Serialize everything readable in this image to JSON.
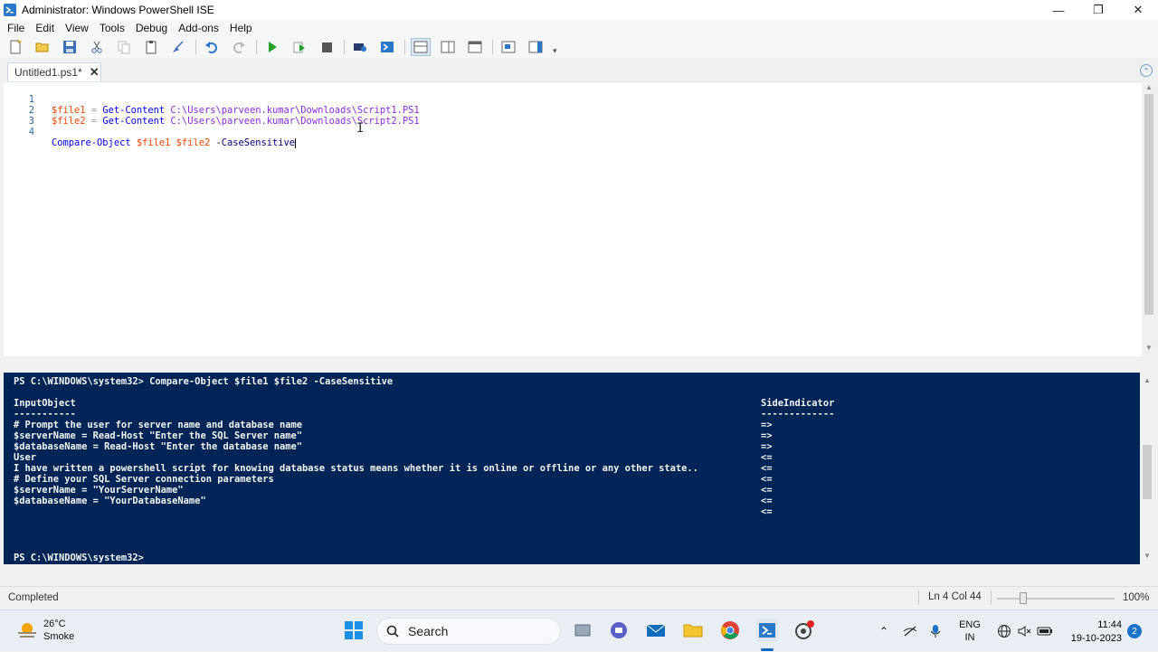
{
  "window": {
    "title": "Administrator: Windows PowerShell ISE",
    "minimize_glyph": "—",
    "maximize_glyph": "❐",
    "close_glyph": "✕"
  },
  "menu": [
    "File",
    "Edit",
    "View",
    "Tools",
    "Debug",
    "Add-ons",
    "Help"
  ],
  "tab": {
    "label": "Untitled1.ps1*",
    "close_glyph": "✕"
  },
  "editor": {
    "lines": [
      {
        "num": "1",
        "var": "$file1",
        "op": " = ",
        "cmd": "Get-Content",
        "arg": "C:\\Users\\parveen.kumar\\Downloads\\Script1.PS1"
      },
      {
        "num": "2",
        "var": "$file2",
        "op": " = ",
        "cmd": "Get-Content",
        "arg": "C:\\Users\\parveen.kumar\\Downloads\\Script2.PS1"
      },
      {
        "num": "3"
      },
      {
        "num": "4",
        "cmd": "Compare-Object",
        "var1": "$file1",
        "var2": "$file2",
        "param": "-CaseSensitive"
      }
    ]
  },
  "console": {
    "command_line": "PS C:\\WINDOWS\\system32> Compare-Object $file1 $file2 -CaseSensitive",
    "col1_header": "InputObject",
    "col1_underline": "-----------",
    "col2_header": "SideIndicator",
    "col2_underline": "-------------",
    "rows": [
      {
        "input": "# Prompt the user for server name and database name",
        "side": "=>"
      },
      {
        "input": "$serverName = Read-Host \"Enter the SQL Server name\"",
        "side": "=>"
      },
      {
        "input": "$databaseName = Read-Host \"Enter the database name\"",
        "side": "=>"
      },
      {
        "input": "User",
        "side": "<="
      },
      {
        "input": "I have written a powershell script for knowing database status means whether it is online or offline or any other state..",
        "side": "<="
      },
      {
        "input": "# Define your SQL Server connection parameters",
        "side": "<="
      },
      {
        "input": "$serverName = \"YourServerName\"",
        "side": "<="
      },
      {
        "input": "$databaseName = \"YourDatabaseName\"",
        "side": "<="
      },
      {
        "input": "",
        "side": "<="
      }
    ],
    "prompt": "PS C:\\WINDOWS\\system32>"
  },
  "status": {
    "text": "Completed",
    "position": "Ln 4  Col 44",
    "zoom": "100%"
  },
  "taskbar": {
    "weather_temp": "26°C",
    "weather_desc": "Smoke",
    "search_label": "Search",
    "lang_line1": "ENG",
    "lang_line2": "IN",
    "time": "11:44",
    "date": "19-10-2023",
    "notification_count": "2"
  },
  "colors": {
    "console_bg": "#012456",
    "variable": "#ff4500",
    "cmdlet": "#0000ff",
    "argument": "#8a2be2",
    "parameter": "#000080"
  }
}
